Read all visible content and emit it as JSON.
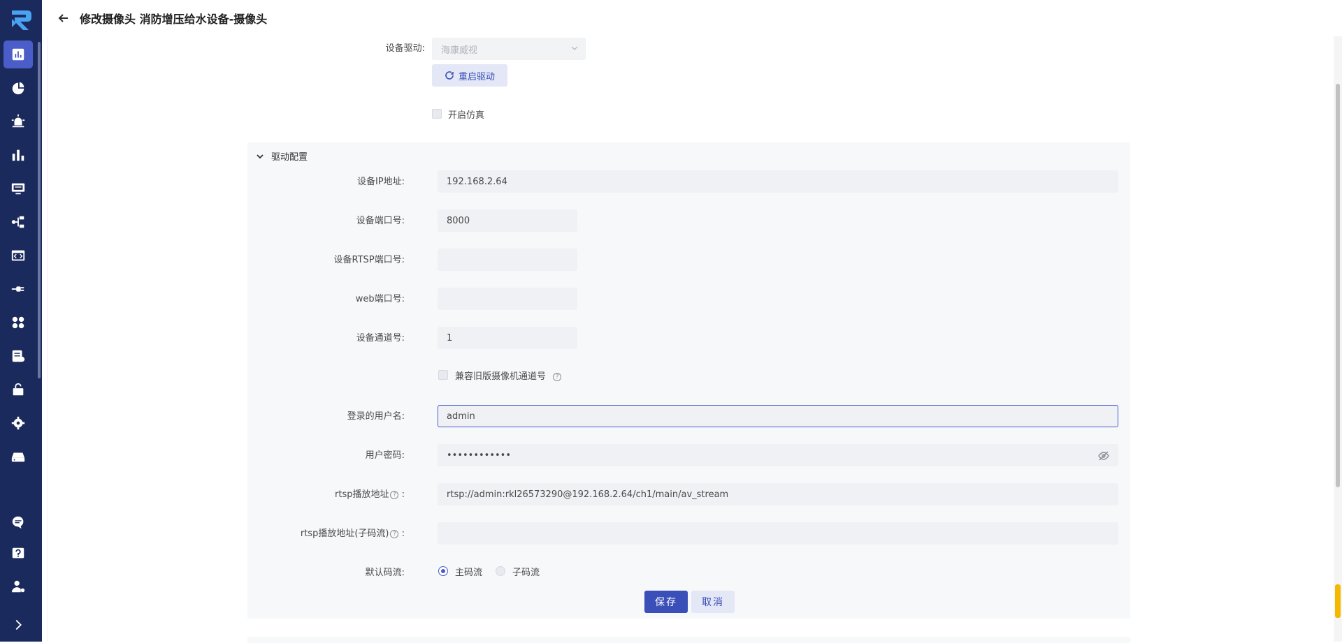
{
  "header": {
    "back_label": "",
    "title": "修改摄像头 消防增压给水设备-摄像头"
  },
  "nav": {
    "items": [
      {
        "name": "dashboard",
        "icon": "chart-board-icon"
      },
      {
        "name": "monitor",
        "icon": "gauge-icon"
      },
      {
        "name": "alarm",
        "icon": "alarm-light-icon"
      },
      {
        "name": "statistics",
        "icon": "bar-chart-icon"
      },
      {
        "name": "screen",
        "icon": "monitor-icon"
      },
      {
        "name": "topology",
        "icon": "flow-icon"
      },
      {
        "name": "code",
        "icon": "code-window-icon"
      },
      {
        "name": "device",
        "icon": "plug-icon"
      },
      {
        "name": "apps",
        "icon": "apps-icon"
      },
      {
        "name": "records",
        "icon": "records-icon"
      },
      {
        "name": "permission",
        "icon": "lock-icon"
      },
      {
        "name": "settings",
        "icon": "gear-icon"
      },
      {
        "name": "gateway",
        "icon": "server-icon"
      },
      {
        "name": "messages",
        "icon": "chat-icon"
      },
      {
        "name": "help",
        "icon": "question-icon"
      },
      {
        "name": "user",
        "icon": "user-settings-icon"
      },
      {
        "name": "expand",
        "icon": "chevron-right-icon"
      }
    ]
  },
  "form": {
    "driver_label": "设备驱动:",
    "driver_value": "海康威视",
    "restart_label": "重启驱动",
    "simulation_label": "开启仿真",
    "section_title": "驱动配置",
    "ip_label": "设备IP地址:",
    "ip_value": "192.168.2.64",
    "port_label": "设备端口号:",
    "port_value": "8000",
    "rtsp_port_label": "设备RTSP端口号:",
    "rtsp_port_value": "",
    "web_port_label": "web端口号:",
    "web_port_value": "",
    "channel_label": "设备通道号:",
    "channel_value": "1",
    "compat_label": "兼容旧版摄像机通道号",
    "username_label": "登录的用户名:",
    "username_value": "admin",
    "password_label": "用户密码:",
    "password_value": "••••••••••••",
    "rtsp_url_label": "rtsp播放地址",
    "rtsp_url_value": "rtsp://admin:rkl26573290@192.168.2.64/ch1/main/av_stream",
    "rtsp_sub_label": "rtsp播放地址(子码流)",
    "rtsp_sub_value": "",
    "stream_label": "默认码流:",
    "stream_options": [
      "主码流",
      "子码流"
    ],
    "stream_selected": "主码流",
    "save_label": "保存",
    "cancel_label": "取消"
  },
  "colors": {
    "rail": "#1b2a5c",
    "accent": "#3b4fb8",
    "panel": "#f7f8fa"
  }
}
